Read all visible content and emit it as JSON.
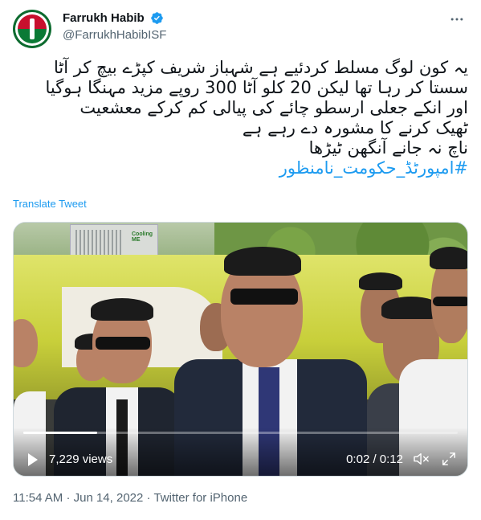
{
  "author": {
    "display_name": "Farrukh Habib",
    "handle": "@FarrukhHabibISF",
    "avatar_icon": "party-flag-bat-avatar",
    "verified_icon": "verified-badge-icon"
  },
  "menu": {
    "icon": "more-options-icon"
  },
  "tweet": {
    "lines": [
      "یہ کون لوگ مسلط کردئیے ہے شہباز شریف کپڑے بیچ کر آٹا",
      "سستا کر رہا تھا لیکن 20 کلو آٹا 300 روپے مزید مہنگا ہوگیا",
      "اور انکے جعلی ارسطو چائے کی پیالی کم کرکے معشعیت",
      "ٹھیک کرنے کا مشورہ دے رہے ہے",
      "ناچ نہ جانے آنگھن ٹیڑھا"
    ],
    "hashtag": "#امپورٹڈ_حکومت_نامنظور",
    "translate_label": "Translate Tweet"
  },
  "video": {
    "views": "7,229 views",
    "time": "0:02 / 0:12",
    "progress_fraction": 0.17,
    "play_icon": "play-icon",
    "mute_icon": "mute-icon",
    "fullscreen_icon": "fullscreen-icon",
    "ac_brand": "Cooling ME"
  },
  "footer": {
    "time": "11:54 AM",
    "separator": "·",
    "date": "Jun 14, 2022",
    "source": "Twitter for iPhone"
  },
  "colors": {
    "link": "#1d9bf0",
    "muted": "#536471",
    "text": "#0f1419"
  }
}
